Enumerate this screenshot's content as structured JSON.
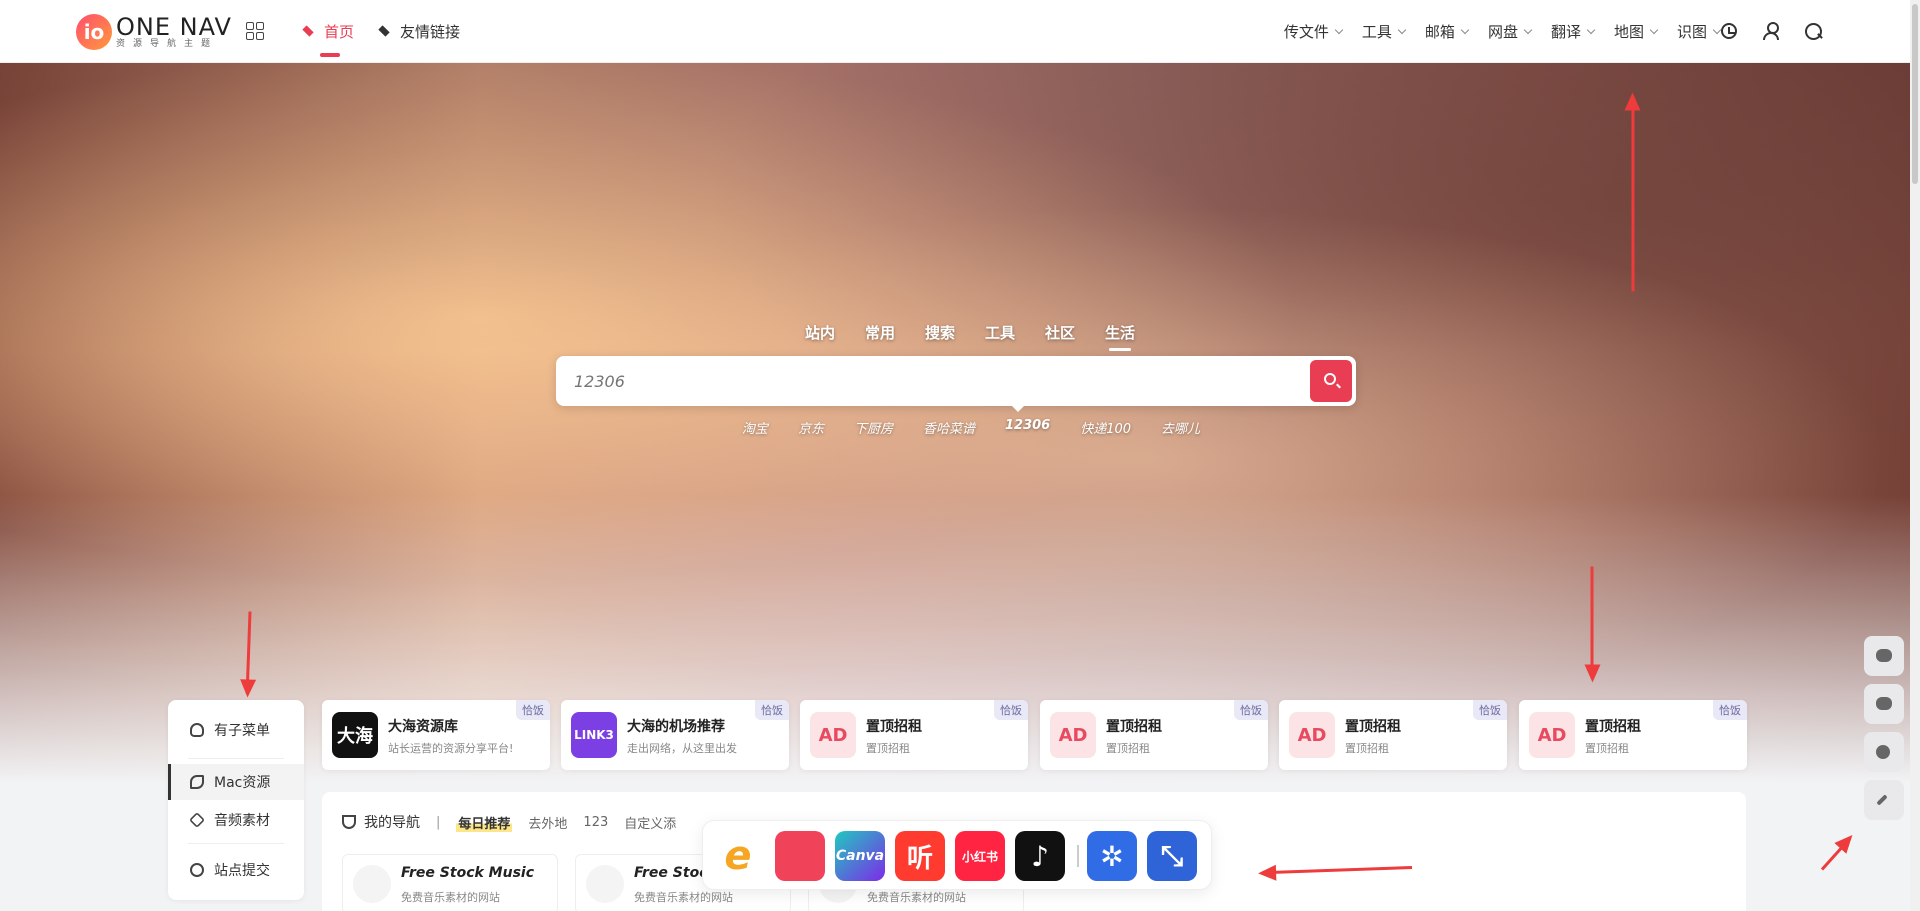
{
  "header": {
    "logo_mark": "io",
    "logo_title": "ONE NAV",
    "logo_sub": "资源导航主题",
    "nav_left": [
      {
        "label": "首页",
        "active": true
      },
      {
        "label": "友情链接",
        "active": false
      }
    ],
    "nav_right": [
      "传文件",
      "工具",
      "邮箱",
      "网盘",
      "翻译",
      "地图",
      "识图"
    ],
    "icons": [
      "alarm-icon",
      "user-icon",
      "search-icon"
    ]
  },
  "search": {
    "tabs": [
      "站内",
      "常用",
      "搜索",
      "工具",
      "社区",
      "生活"
    ],
    "active_tab": "生活",
    "placeholder": "12306",
    "engines": [
      "淘宝",
      "京东",
      "下厨房",
      "香哈菜谱",
      "12306",
      "快递100",
      "去哪儿"
    ],
    "active_engine": "12306"
  },
  "side_menu": {
    "items": [
      {
        "label": "有子菜单",
        "icon": "bulb-icon"
      },
      {
        "label": "Mac资源",
        "icon": "butterfly-icon",
        "active": true
      },
      {
        "label": "音频素材",
        "icon": "stack-icon"
      },
      {
        "label": "站点提交",
        "icon": "compass-icon"
      }
    ]
  },
  "ad_cards": [
    {
      "logo": "大海",
      "title": "大海资源库",
      "desc": "站长运营的资源分享平台!",
      "tag": "恰饭",
      "color": "#111111"
    },
    {
      "logo": "LINK3",
      "title": "大海的机场推荐",
      "desc": "走出网络，从这里出发",
      "tag": "恰饭",
      "color": "#7b3fe4"
    },
    {
      "logo": "AD",
      "title": "置顶招租",
      "desc": "置顶招租",
      "tag": "恰饭",
      "color": "#fbe3e6"
    },
    {
      "logo": "AD",
      "title": "置顶招租",
      "desc": "置顶招租",
      "tag": "恰饭",
      "color": "#fbe3e6"
    },
    {
      "logo": "AD",
      "title": "置顶招租",
      "desc": "置顶招租",
      "tag": "恰饭",
      "color": "#fbe3e6"
    },
    {
      "logo": "AD",
      "title": "置顶招租",
      "desc": "置顶招租",
      "tag": "恰饭",
      "color": "#fbe3e6"
    }
  ],
  "panel": {
    "title": "我的导航",
    "separator": "|",
    "tabs": [
      "每日推荐",
      "去外地",
      "123",
      "自定义添"
    ],
    "sites": [
      {
        "title": "Free Stock Music",
        "desc": "免费音乐素材的网站"
      },
      {
        "title": "Free Stock",
        "desc": "免费音乐素材的网站"
      },
      {
        "title": "",
        "desc": "免费音乐素材的网站"
      }
    ]
  },
  "dock": {
    "apps": [
      {
        "name": "e-app-icon",
        "label": "e",
        "color": "#f5a623"
      },
      {
        "name": "flower-app-icon",
        "label": "",
        "color": "#f0435a"
      },
      {
        "name": "canva-app-icon",
        "label": "Canva",
        "color": "#20b6c9"
      },
      {
        "name": "ting-app-icon",
        "label": "听",
        "color": "#ff3b30"
      },
      {
        "name": "xiaohongshu-app-icon",
        "label": "小红书",
        "color": "#ff2442"
      },
      {
        "name": "tiktok-app-icon",
        "label": "♪",
        "color": "#111111"
      },
      {
        "name": "pinwheel-app-icon",
        "label": "✲",
        "color": "#2f6ce5"
      },
      {
        "name": "shrink-app-icon",
        "label": "⤡",
        "color": "#2f64d9"
      }
    ]
  },
  "float_tools": [
    "wechat-icon",
    "qq-icon",
    "moon-icon",
    "chevrons-icon"
  ],
  "colors": {
    "accent": "#e83d53",
    "arrow": "#ee3b3b"
  }
}
